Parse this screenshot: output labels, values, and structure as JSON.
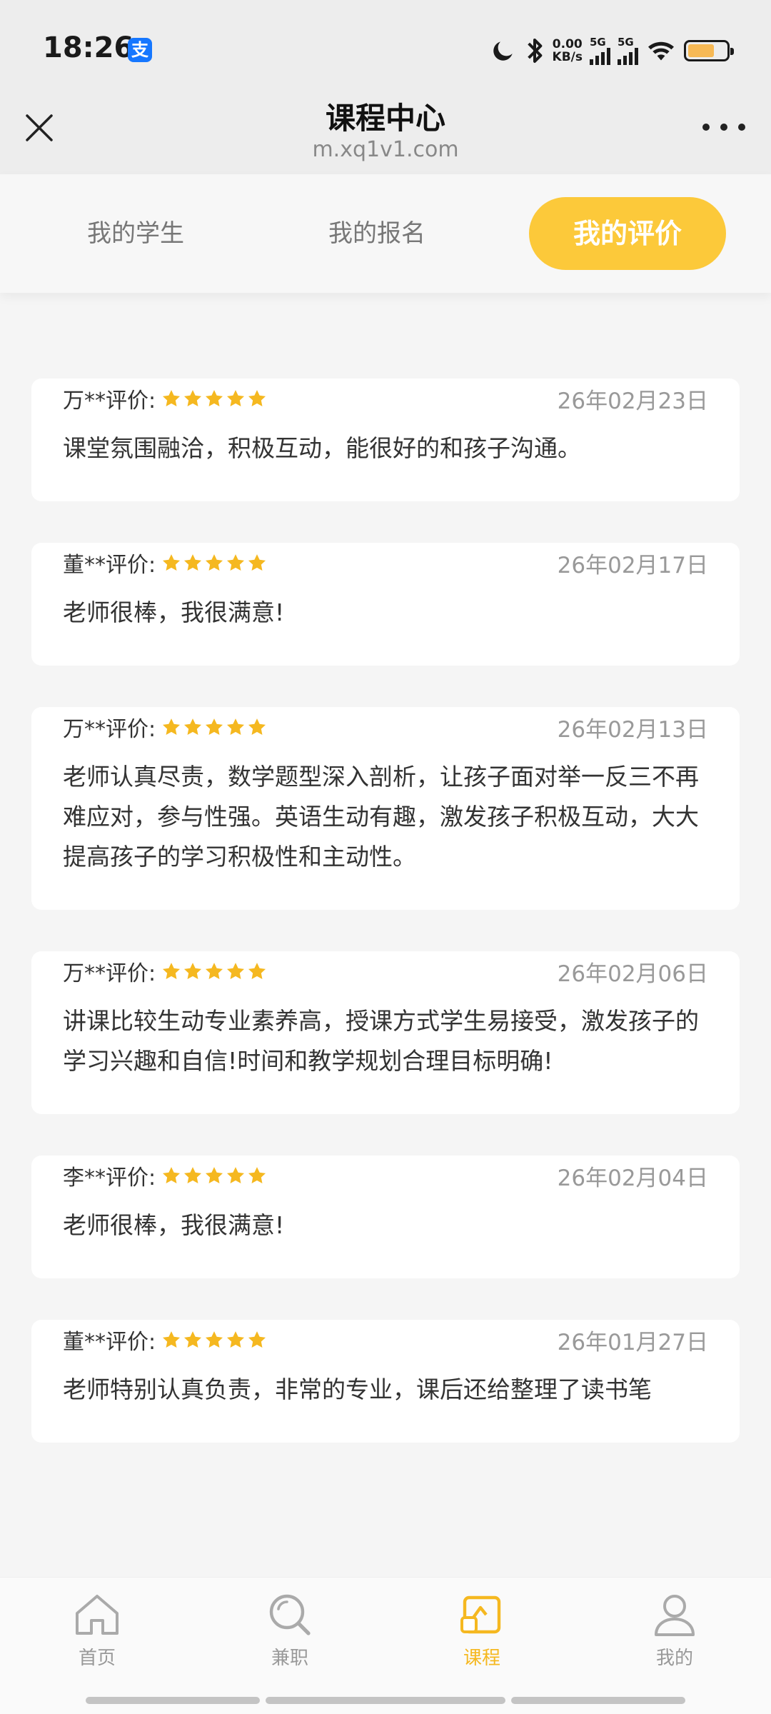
{
  "status_bar": {
    "time": "18:26",
    "app_badge": "支",
    "net_speed_value": "0.00",
    "net_speed_unit": "KB/s",
    "sim1_label": "5G",
    "sim2_label": "5G",
    "battery_level": 0.7
  },
  "nav": {
    "title": "课程中心",
    "url": "m.xq1v1.com"
  },
  "tabs": [
    {
      "label": "我的学生",
      "active": false
    },
    {
      "label": "我的报名",
      "active": false
    },
    {
      "label": "我的评价",
      "active": true
    }
  ],
  "reviews": [
    {
      "reviewer": "万**评价:",
      "stars": 5,
      "date": "26年02月23日",
      "comment": "课堂氛围融洽，积极互动，能很好的和孩子沟通。"
    },
    {
      "reviewer": "董**评价:",
      "stars": 5,
      "date": "26年02月17日",
      "comment": "老师很棒，我很满意!"
    },
    {
      "reviewer": "万**评价:",
      "stars": 5,
      "date": "26年02月13日",
      "comment": "老师认真尽责，数学题型深入剖析，让孩子面对举一反三不再难应对，参与性强。英语生动有趣，激发孩子积极互动，大大提高孩子的学习积极性和主动性。"
    },
    {
      "reviewer": "万**评价:",
      "stars": 5,
      "date": "26年02月06日",
      "comment": "讲课比较生动专业素养高，授课方式学生易接受，激发孩子的学习兴趣和自信!时间和教学规划合理目标明确!"
    },
    {
      "reviewer": "李**评价:",
      "stars": 5,
      "date": "26年02月04日",
      "comment": "老师很棒，我很满意!"
    },
    {
      "reviewer": "董**评价:",
      "stars": 5,
      "date": "26年01月27日",
      "comment": "老师特别认真负责，非常的专业，课后还给整理了读书笔"
    }
  ],
  "bottom_nav": [
    {
      "label": "首页",
      "icon": "home-icon",
      "active": false
    },
    {
      "label": "兼职",
      "icon": "search-icon",
      "active": false
    },
    {
      "label": "课程",
      "icon": "course-icon",
      "active": true
    },
    {
      "label": "我的",
      "icon": "profile-icon",
      "active": false
    }
  ],
  "colors": {
    "accent": "#fcc93a",
    "star": "#f5b820",
    "background": "#f5f5f5"
  }
}
